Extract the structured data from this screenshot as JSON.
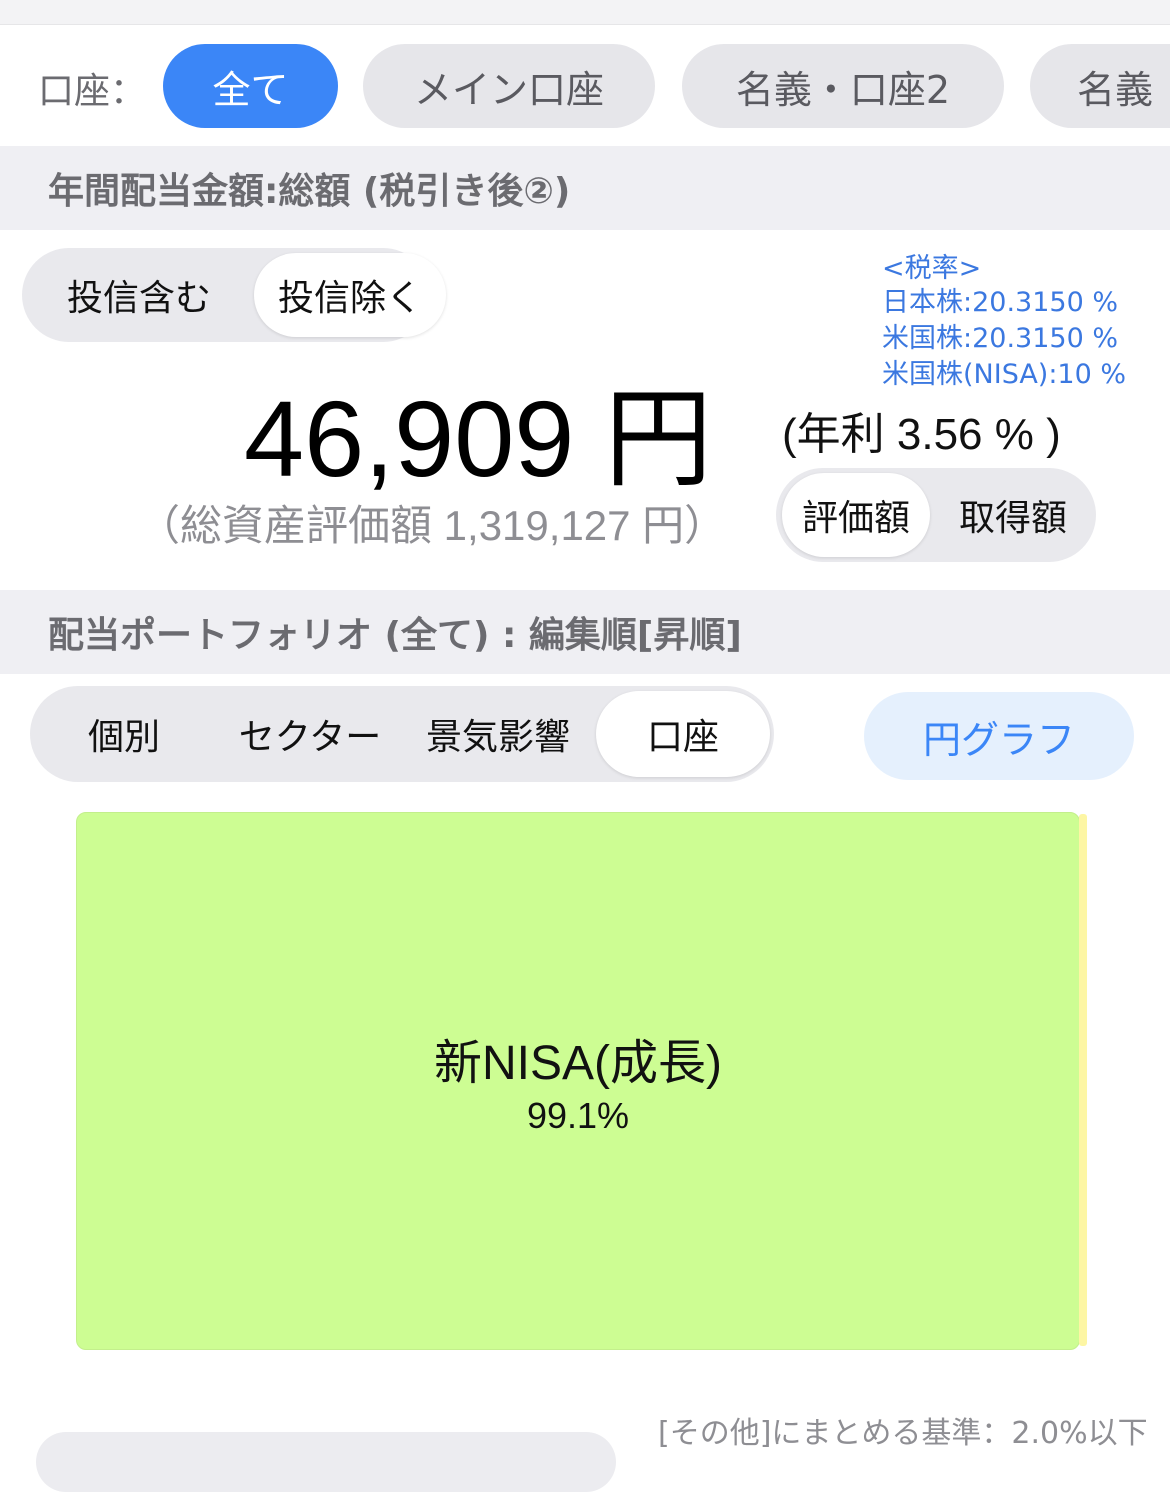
{
  "account_filter": {
    "label": "口座：",
    "chips": [
      "全て",
      "メイン口座",
      "名義・口座2",
      "名義"
    ],
    "selected": "全て"
  },
  "annual_dividend": {
    "header": "年間配当金額:総額 (税引き後②)",
    "fund_toggle": {
      "include": "投信含む",
      "exclude": "投信除く",
      "selected": "投信除く"
    },
    "tax_rates": {
      "title": "<税率>",
      "jp": "日本株:20.3150 %",
      "us": "米国株:20.3150 %",
      "us_nisa": "米国株(NISA):10 %"
    },
    "amount": "46,909 円",
    "yield": "(年利 3.56 % )",
    "total_assets": "（総資産評価額 1,319,127 円）",
    "basis_toggle": {
      "valuation": "評価額",
      "acquisition": "取得額",
      "selected": "評価額"
    }
  },
  "portfolio": {
    "header": "配当ポートフォリオ (全て) : 編集順[昇順]",
    "tabs": [
      "個別",
      "セクター",
      "景気影響",
      "口座"
    ],
    "selected_tab": "口座",
    "pie_button": "円グラフ",
    "footnote": "[その他]にまとめる基準：2.0%以下"
  },
  "chart_data": {
    "type": "treemap",
    "items": [
      {
        "name": "新NISA(成長)",
        "percent": 99.1,
        "label": "99.1%",
        "color": "#cdfd93"
      },
      {
        "name": "",
        "percent": 0.9,
        "label": "",
        "color": "#fdf6a4"
      }
    ]
  },
  "colors": {
    "accent": "#3b86f7",
    "tax_text": "#3b78e0",
    "header_bg": "#efeff3",
    "treemap_main": "#cdfd93",
    "treemap_other": "#fdf6a4"
  }
}
